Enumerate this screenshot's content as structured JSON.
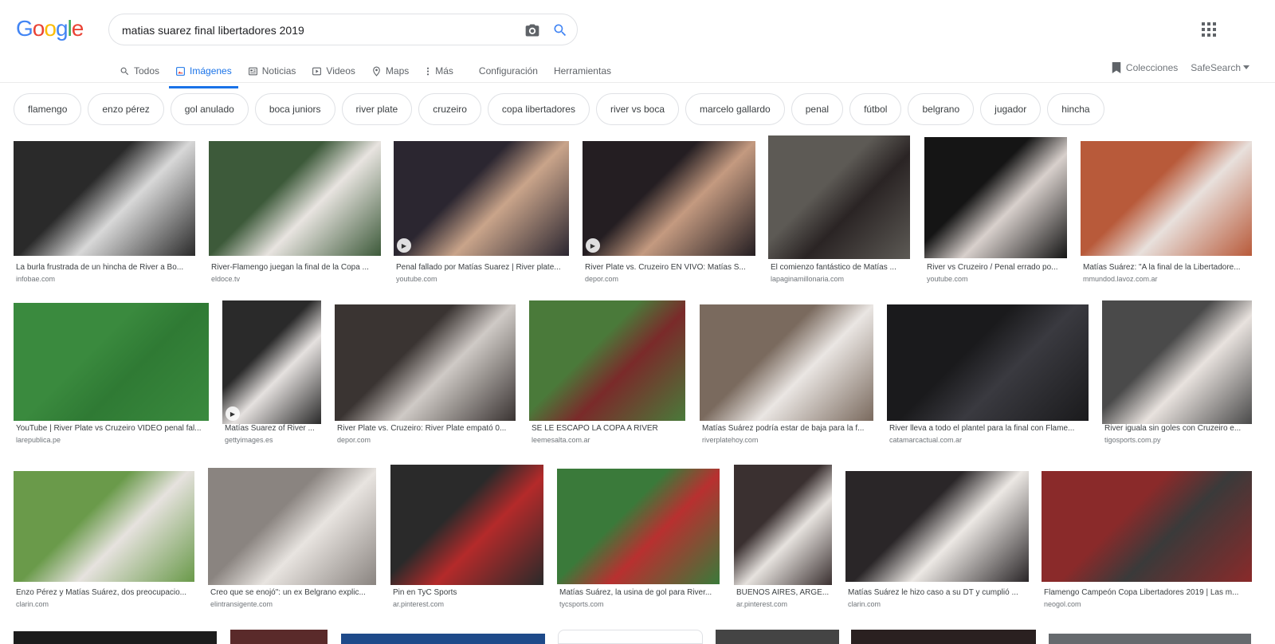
{
  "header": {
    "logo_letters": [
      "G",
      "o",
      "o",
      "g",
      "l",
      "e"
    ],
    "logo_colors": [
      "#4285f4",
      "#ea4335",
      "#fbbc05",
      "#4285f4",
      "#34a853",
      "#ea4335"
    ],
    "query": "matias suarez final libertadores 2019"
  },
  "tabs": [
    {
      "label": "Todos",
      "icon": "search-icon"
    },
    {
      "label": "Imágenes",
      "icon": "image-icon"
    },
    {
      "label": "Noticias",
      "icon": "news-icon"
    },
    {
      "label": "Videos",
      "icon": "video-icon"
    },
    {
      "label": "Maps",
      "icon": "map-pin-icon"
    },
    {
      "label": "Más",
      "icon": "more-vert-icon"
    }
  ],
  "tools": {
    "settings": "Configuración",
    "tools": "Herramientas"
  },
  "header_right": {
    "collections": "Colecciones",
    "safesearch": "SafeSearch"
  },
  "chips": [
    "flamengo",
    "enzo pérez",
    "gol anulado",
    "boca juniors",
    "river plate",
    "cruzeiro",
    "copa libertadores",
    "river vs boca",
    "marcelo gallardo",
    "penal",
    "fútbol",
    "belgrano",
    "jugador",
    "hincha"
  ],
  "accent": "#1a73e8",
  "results": [
    {
      "title": "La burla frustrada de un hincha de River a Bo...",
      "source": "infobae.com",
      "palette": [
        "#2a2a2a",
        "#d8d8d8"
      ]
    },
    {
      "title": "River-Flamengo juegan la final de la Copa ...",
      "source": "eldoce.tv",
      "palette": [
        "#3d5a3a",
        "#e8e4e0"
      ]
    },
    {
      "title": "Penal fallado por Matías Suarez | River plate...",
      "source": "youtube.com",
      "palette": [
        "#2b2630",
        "#c9a48a"
      ],
      "video": true
    },
    {
      "title": "River Plate vs. Cruzeiro EN VIVO: Matías S...",
      "source": "depor.com",
      "palette": [
        "#241e22",
        "#c49a80"
      ],
      "video": true
    },
    {
      "title": "El comienzo fantástico de Matías ...",
      "source": "lapaginamillonaria.com",
      "palette": [
        "#5d5a55",
        "#2a2424"
      ]
    },
    {
      "title": "River vs Cruzeiro / Penal errado po...",
      "source": "youtube.com",
      "palette": [
        "#151515",
        "#d8d0cc"
      ]
    },
    {
      "title": "Matías Suárez: \"A la final de la Libertadore...",
      "source": "mmundod.lavoz.com.ar",
      "palette": [
        "#b85a3a",
        "#e8e0dc"
      ]
    },
    {
      "title": "YouTube | River Plate vs Cruzeiro VIDEO penal fal...",
      "source": "larepublica.pe",
      "palette": [
        "#3a8a3e",
        "#2f7a34"
      ]
    },
    {
      "title": "Matías Suarez of River ...",
      "source": "gettyimages.es",
      "palette": [
        "#2a2a2a",
        "#e5e1df"
      ],
      "video": true
    },
    {
      "title": "River Plate vs. Cruzeiro: River Plate empató 0...",
      "source": "depor.com",
      "palette": [
        "#3a3432",
        "#cfcac6"
      ]
    },
    {
      "title": "SE LE ESCAPÓ LA COPA A RIVER",
      "source": "leemesalta.com.ar",
      "palette": [
        "#4a7a3a",
        "#7a2a2a"
      ]
    },
    {
      "title": "Matías Suárez podría estar de baja para la f...",
      "source": "riverplatehoy.com",
      "palette": [
        "#7a6a5e",
        "#eae6e3"
      ]
    },
    {
      "title": "River lleva a todo el plantel para la final con Flame...",
      "source": "catamarcactual.com.ar",
      "palette": [
        "#1a1a1c",
        "#3a3a40"
      ]
    },
    {
      "title": "River iguala sin goles con Cruzeiro e...",
      "source": "tigosports.com.py",
      "palette": [
        "#4a4a4a",
        "#e8e2de"
      ]
    },
    {
      "title": "Enzo Pérez y Matías Suárez, dos preocupacio...",
      "source": "clarin.com",
      "palette": [
        "#6a9a4a",
        "#e6e2de"
      ]
    },
    {
      "title": "Creo que se enojó\": un ex Belgrano explic...",
      "source": "elintransigente.com",
      "palette": [
        "#8a8480",
        "#e8e4e0"
      ]
    },
    {
      "title": "Pin en TyC Sports",
      "source": "ar.pinterest.com",
      "palette": [
        "#2a2a2a",
        "#b42a2a"
      ]
    },
    {
      "title": "Matías Suárez, la usina de gol para River...",
      "source": "tycsports.com",
      "palette": [
        "#3a7a3a",
        "#b83030"
      ]
    },
    {
      "title": "BUENOS AIRES, ARGE...",
      "source": "ar.pinterest.com",
      "palette": [
        "#3a3030",
        "#e6e2de"
      ]
    },
    {
      "title": "Matías Suárez le hizo caso a su DT y cumplió ...",
      "source": "clarin.com",
      "palette": [
        "#2a2628",
        "#ece8e4"
      ]
    },
    {
      "title": "Flamengo Campeón Copa Libertadores 2019 | Las m...",
      "source": "neogol.com",
      "palette": [
        "#8a2a2a",
        "#3a3a3a"
      ]
    }
  ]
}
